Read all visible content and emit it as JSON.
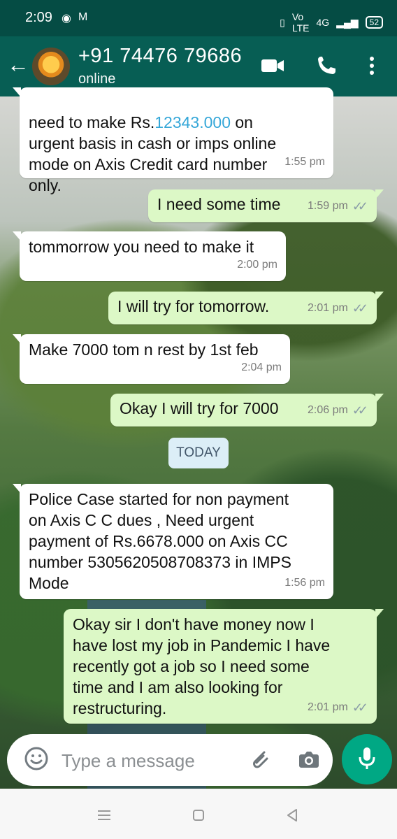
{
  "status_bar": {
    "time": "2:09",
    "left_icons": [
      "chrome-icon",
      "gmail-icon"
    ],
    "network_labels": [
      "Vo",
      "LTE",
      "4G"
    ],
    "battery": "52"
  },
  "header": {
    "contact_name": "+91 74476 79686",
    "status": "online",
    "icons": [
      "back-arrow-icon",
      "video-call-icon",
      "phone-call-icon",
      "more-menu-icon"
    ]
  },
  "chat": {
    "date_separator": "TODAY",
    "messages": [
      {
        "direction": "in",
        "text": "need to make Rs.",
        "highlight": "12343.000",
        "text_after": " on\nurgent basis in cash or imps online\nmode on Axis Credit card number\nonly.",
        "time": "1:55 pm"
      },
      {
        "direction": "out",
        "text": "I need some time",
        "time": "1:59 pm"
      },
      {
        "direction": "in",
        "text": "tommorrow you need to make it",
        "time": "2:00 pm"
      },
      {
        "direction": "out",
        "text": "I will try for  tomorrow.",
        "time": "2:01 pm"
      },
      {
        "direction": "in",
        "text": "Make 7000 tom n rest by 1st feb",
        "time": "2:04 pm"
      },
      {
        "direction": "out",
        "text": "Okay I will try for 7000",
        "time": "2:06 pm"
      },
      {
        "direction": "in",
        "text": "Police Case started for non payment\non Axis C C dues , Need urgent\npayment of Rs.6678.000  on Axis CC\nnumber 5305620508708373 in IMPS\nMode",
        "time": "1:56 pm"
      },
      {
        "direction": "out",
        "text": "Okay sir I don't have money now I\nhave lost my job in Pandemic I have\nrecently got a job so  I need some\ntime and I am also looking for\nrestructuring.",
        "time": "2:01 pm"
      }
    ]
  },
  "composer": {
    "placeholder": "Type a message",
    "icons": [
      "emoji-icon",
      "attachment-icon",
      "camera-icon",
      "microphone-icon"
    ]
  },
  "navigation_bar": {
    "icons": [
      "recent-apps-icon",
      "home-icon",
      "back-nav-icon"
    ]
  },
  "colors": {
    "header": "#075e54",
    "status_bar": "#054c44",
    "incoming_bubble": "#ffffff",
    "outgoing_bubble": "#dcf8c6",
    "mic_button": "#00a884",
    "date_pill": "#dceef7",
    "link_text": "#35a7d8"
  }
}
